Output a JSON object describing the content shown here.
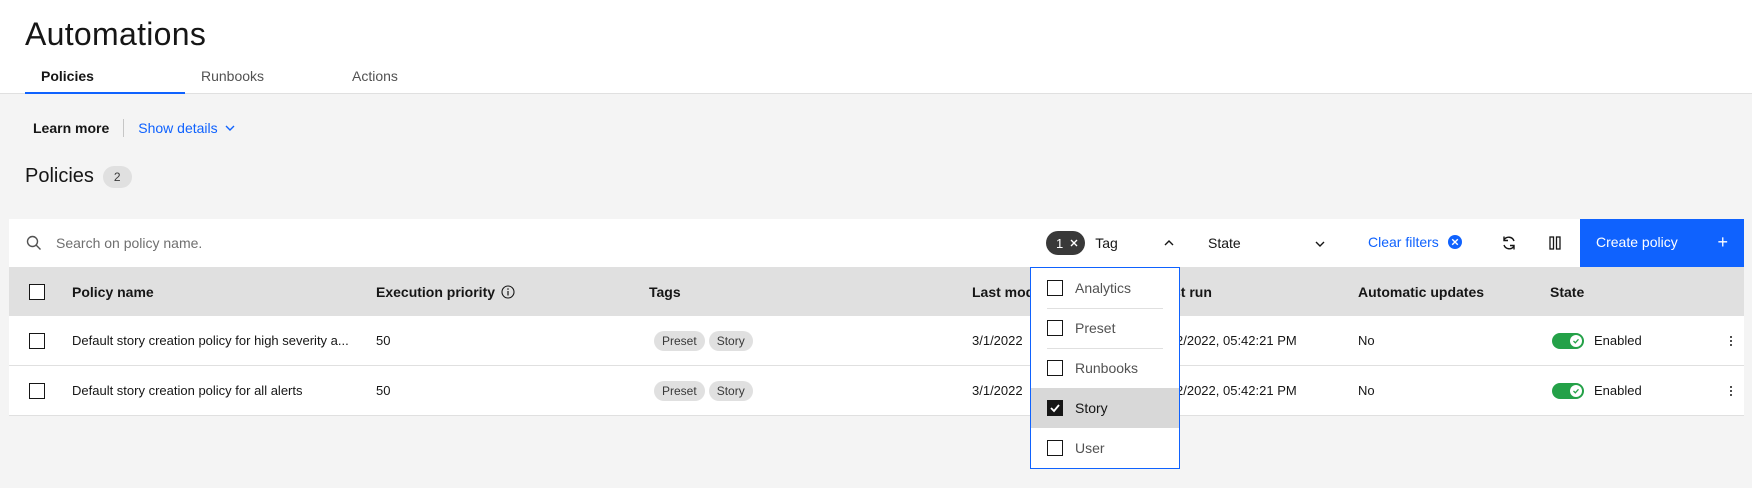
{
  "page": {
    "title": "Automations"
  },
  "tabs": [
    {
      "label": "Policies",
      "active": true
    },
    {
      "label": "Runbooks",
      "active": false
    },
    {
      "label": "Actions",
      "active": false
    }
  ],
  "info": {
    "learn_more": "Learn more",
    "show_details": "Show details"
  },
  "section": {
    "title": "Policies",
    "count": "2"
  },
  "toolbar": {
    "search_placeholder": "Search on policy name.",
    "tag_filter": {
      "count": "1",
      "label": "Tag"
    },
    "state_filter": {
      "label": "State"
    },
    "clear_filters": "Clear filters",
    "create_button": "Create policy",
    "create_icon": "+"
  },
  "table": {
    "headers": {
      "name": "Policy name",
      "priority": "Execution priority",
      "tags": "Tags",
      "modified": "Last mod",
      "last_run": "st run",
      "updates": "Automatic updates",
      "state": "State"
    },
    "rows": [
      {
        "name": "Default story creation policy for high severity a...",
        "priority": "50",
        "tags": [
          "Preset",
          "Story"
        ],
        "modified": "3/1/2022",
        "last_run": "2/2022, 05:42:21 PM",
        "updates": "No",
        "state": "Enabled"
      },
      {
        "name": "Default story creation policy for all alerts",
        "priority": "50",
        "tags": [
          "Preset",
          "Story"
        ],
        "modified": "3/1/2022",
        "last_run": "2/2022, 05:42:21 PM",
        "updates": "No",
        "state": "Enabled"
      }
    ]
  },
  "tag_dropdown": {
    "options": [
      {
        "label": "Analytics",
        "checked": false
      },
      {
        "label": "Preset",
        "checked": false
      },
      {
        "label": "Runbooks",
        "checked": false
      },
      {
        "label": "Story",
        "checked": true
      },
      {
        "label": "User",
        "checked": false
      }
    ]
  },
  "colors": {
    "primary": "#0f62fe",
    "toggle_on": "#24a148",
    "header_row": "#e0e0e0",
    "page_bg": "#f4f4f4"
  }
}
